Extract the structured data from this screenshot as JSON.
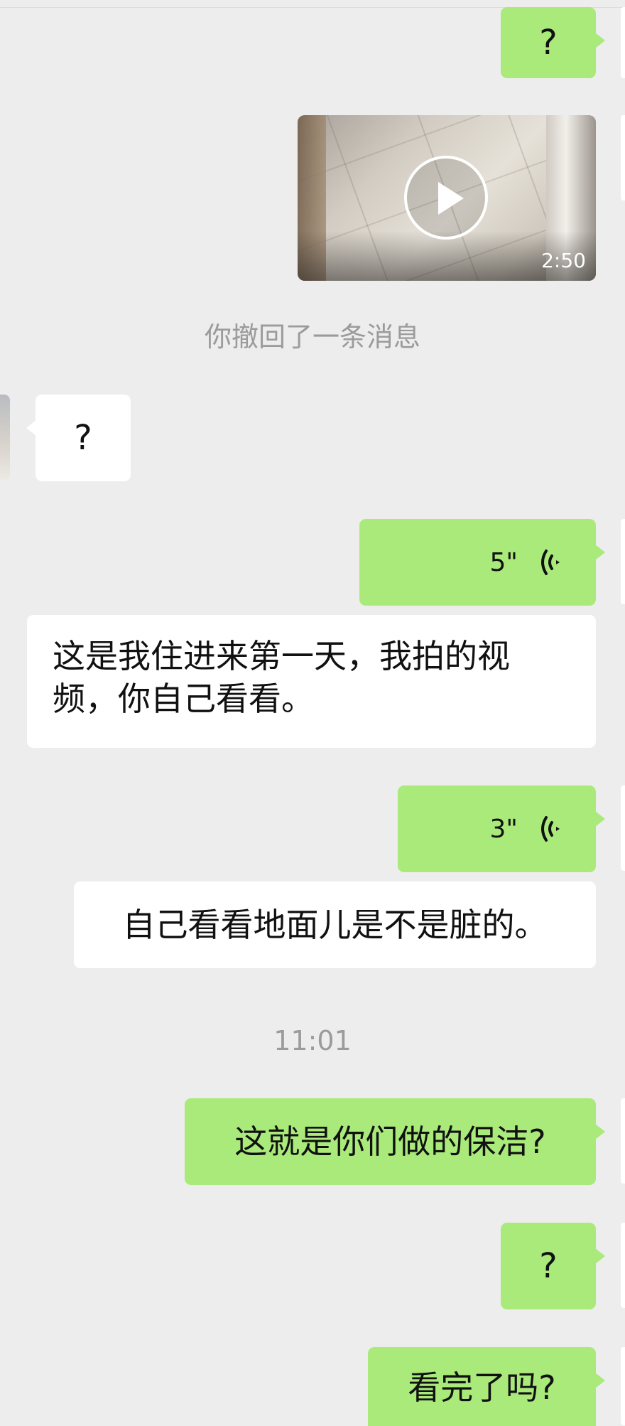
{
  "messages": {
    "m1": {
      "text": "?"
    },
    "video": {
      "duration": "2:50"
    },
    "recall_notice": "你撤回了一条消息",
    "m3": {
      "text": "?"
    },
    "voice1": {
      "duration": "5\""
    },
    "m5": {
      "text": "这是我住进来第一天，我拍的视频，你自己看看。"
    },
    "voice2": {
      "duration": "3\""
    },
    "m7": {
      "text": "自己看看地面儿是不是脏的。"
    },
    "timestamp": "11:01",
    "m8": {
      "text": "这就是你们做的保洁?"
    },
    "m9": {
      "text": "?"
    },
    "m10": {
      "text": "看完了吗?"
    }
  },
  "colors": {
    "sent_bubble": "#a9ea7a",
    "received_bubble": "#ffffff",
    "background": "#ededed"
  }
}
